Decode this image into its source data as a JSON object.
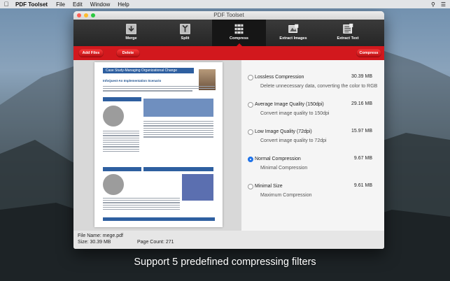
{
  "menubar": {
    "app_name": "PDF Toolset",
    "items": [
      "File",
      "Edit",
      "Window",
      "Help"
    ]
  },
  "window": {
    "title": "PDF Toolset"
  },
  "toolbar": {
    "tools": [
      {
        "label": "Merge",
        "icon": "merge-icon"
      },
      {
        "label": "Split",
        "icon": "split-icon"
      },
      {
        "label": "Compress",
        "icon": "compress-icon",
        "active": true
      },
      {
        "label": "Extract Images",
        "icon": "extract-images-icon"
      },
      {
        "label": "Extract Text",
        "icon": "extract-text-icon"
      }
    ]
  },
  "actions": {
    "add_files": "Add Files",
    "delete": "Delete",
    "compress": "Compress"
  },
  "preview": {
    "doc_title": "Case Study-Managing Organizational Change",
    "doc_subtitle": "InfoQuest-An Implementation Scenario"
  },
  "options": [
    {
      "name": "Lossless Compression",
      "size": "30.39 MB",
      "desc": "Delete unnecessary data, converting the color to RGB",
      "selected": false
    },
    {
      "name": "Average Image Quality (150dpi)",
      "size": "29.16 MB",
      "desc": "Convert image quality to 150dpi",
      "selected": false
    },
    {
      "name": "Low Image Quality (72dpi)",
      "size": "15.97 MB",
      "desc": "Convert image quality to 72dpi",
      "selected": false
    },
    {
      "name": "Normal Compression",
      "size": "9.67 MB",
      "desc": "Minimal Compression",
      "selected": true
    },
    {
      "name": "Minimal Size",
      "size": "9.61 MB",
      "desc": "Maximum Compression",
      "selected": false
    }
  ],
  "status": {
    "file_name": "File Name:  mege.pdf",
    "size": "Size:  30.39 MB",
    "page_count": "Page Count: 271"
  },
  "caption": "Support 5 predefined compressing filters",
  "colors": {
    "accent_red": "#d2181d",
    "selected_radio": "#1e72e8",
    "toolbar_dark": "#262626"
  }
}
